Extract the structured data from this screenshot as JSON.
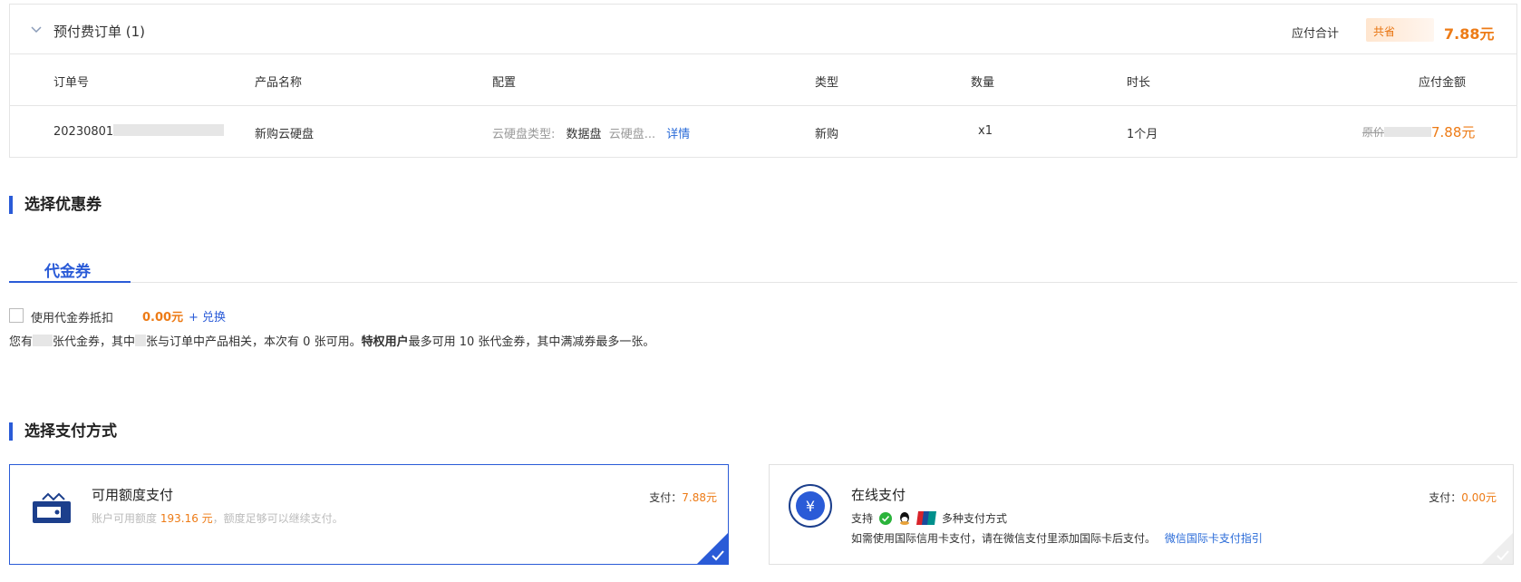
{
  "order": {
    "title": "预付费订单 (1)",
    "total_label": "应付合计",
    "save_label": "共省",
    "total_amount": "7.88元",
    "columns": [
      "订单号",
      "产品名称",
      "配置",
      "类型",
      "数量",
      "时长",
      "应付金额"
    ],
    "row": {
      "order_id_prefix": "20230801",
      "product": "新购云硬盘",
      "config_label": "云硬盘类型:",
      "config_value": "数据盘",
      "config_more": "云硬盘...",
      "details_link": "详情",
      "type": "新购",
      "qty": "x1",
      "duration": "1个月",
      "orig_label": "原价",
      "price": "7.88元"
    }
  },
  "coupon_section": {
    "title": "选择优惠券",
    "tab": "代金券",
    "use_label": "使用代金券抵扣",
    "amount": "0.00元",
    "exchange": "+ 兑换",
    "note_1": "您有",
    "note_2": "张代金券，其中",
    "note_3": "张与订单中产品相关，本次有 0 张可用。",
    "note_bold": "特权用户",
    "note_4": "最多可用 10 张代金券，其中满减券最多一张。"
  },
  "payment_section": {
    "title": "选择支付方式",
    "credit": {
      "title": "可用额度支付",
      "desc_1": "账户可用额度",
      "desc_amount": "193.16 元",
      "desc_2": "，额度足够可以继续支付。",
      "pay_label": "支付：",
      "pay_amount": "7.88元"
    },
    "online": {
      "title": "在线支付",
      "support_label": "支持",
      "multi": "多种支付方式",
      "note": "如需使用国际信用卡支付，请在微信支付里添加国际卡后支付。",
      "link": "微信国际卡支付指引",
      "pay_label": "支付：",
      "pay_amount": "0.00元"
    }
  },
  "colors": {
    "accent": "#2a5bd7",
    "price": "#ed7b16",
    "border": "#e5e5e5"
  },
  "icons": [
    "chevron-down-icon",
    "wallet-icon",
    "yuan-icon",
    "wechat-icon",
    "qq-icon",
    "unionpay-icon",
    "check-icon"
  ]
}
